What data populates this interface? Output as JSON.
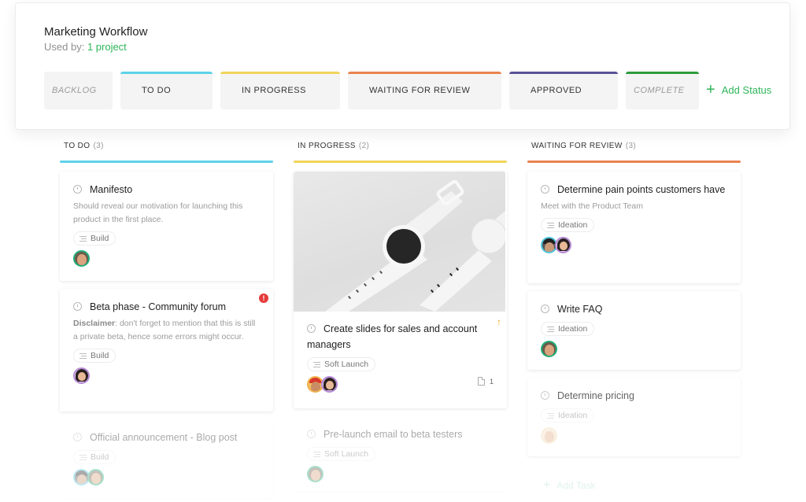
{
  "workflow": {
    "title": "Marketing Workflow",
    "used_by_label": "Used by:",
    "used_by_link": "1 project",
    "statuses": [
      {
        "label": "BACKLOG",
        "color": null,
        "muted": true
      },
      {
        "label": "TO DO",
        "color": "#5dd2e8",
        "muted": false
      },
      {
        "label": "IN PROGRESS",
        "color": "#f2d45c",
        "muted": false
      },
      {
        "label": "WAITING FOR REVIEW",
        "color": "#e9824f",
        "muted": false
      },
      {
        "label": "APPROVED",
        "color": "#5a5296",
        "muted": false
      },
      {
        "label": "COMPLETE",
        "color": "#2e9a3a",
        "muted": true
      }
    ],
    "add_status_label": "Add Status"
  },
  "board": {
    "columns": [
      {
        "name": "TO DO",
        "count": "(3)",
        "color": "#5dd2e8",
        "cards": [
          {
            "title": "Manifesto",
            "description": "Should reveal our motivation for launching this product in the first place.",
            "tag": "Build",
            "assignees": [
              "green-ring-man"
            ]
          },
          {
            "title": "Beta phase - Community forum",
            "description_bold": "Disclaimer",
            "description": ": don't forget to mention that this is still a private beta, hence some errors might occur.",
            "tag": "Build",
            "alert": "!",
            "assignees": [
              "purple-ring-woman"
            ]
          },
          {
            "title": "Official announcement - Blog post",
            "tag": "Build",
            "assignees": [
              "blue-ring-man",
              "green-ring-man"
            ]
          }
        ]
      },
      {
        "name": "IN PROGRESS",
        "count": "(2)",
        "color": "#f2d45c",
        "cards": [
          {
            "title": "Create slides for sales and account managers",
            "image": "smartwatches",
            "tag": "Soft Launch",
            "priority": "↑",
            "attachments": "1",
            "assignees": [
              "orange-ring-man",
              "purple-ring-woman"
            ]
          },
          {
            "title": "Pre-launch email to beta testers",
            "tag": "Soft Launch",
            "assignees": [
              "green-ring-man"
            ]
          }
        ]
      },
      {
        "name": "WAITING FOR REVIEW",
        "count": "(3)",
        "color": "#e9824f",
        "cards": [
          {
            "title": "Determine pain points customers have",
            "description": "Meet with the Product Team",
            "tag": "Ideation",
            "assignees": [
              "blue-ring-man",
              "purple-ring-woman"
            ]
          },
          {
            "title": "Write FAQ",
            "tag": "Ideation",
            "assignees": [
              "green-ring-man"
            ]
          },
          {
            "title": "Determine pricing",
            "tag": "Ideation",
            "assignees": [
              "orange-ring-man"
            ]
          }
        ],
        "add_task_label": "Add Task"
      }
    ]
  }
}
